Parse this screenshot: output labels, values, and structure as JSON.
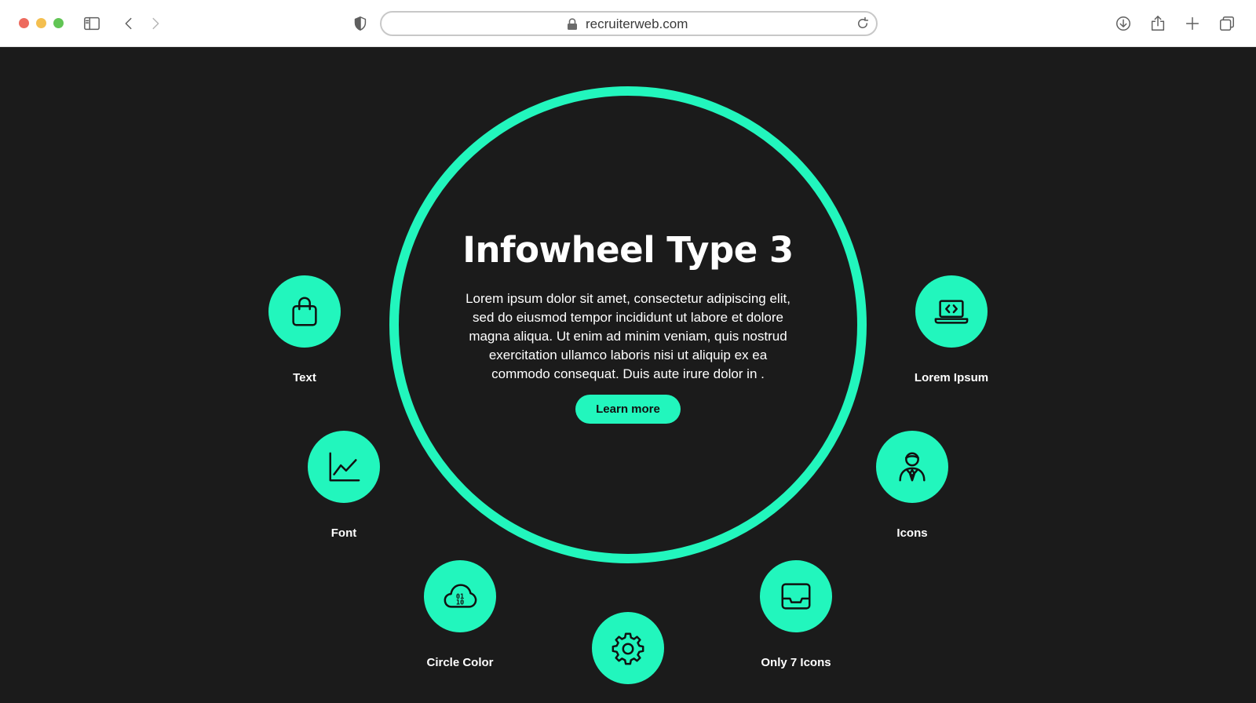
{
  "browser": {
    "url": "recruiterweb.com"
  },
  "main": {
    "title": "Infowheel Type 3",
    "body": "Lorem ipsum dolor sit amet, consectetur adipiscing elit, sed do eiusmod tempor incididunt ut labore et dolore magna aliqua. Ut enim ad minim veniam, quis nostrud exercitation ullamco laboris nisi ut aliquip ex ea commodo consequat. Duis aute irure dolor in .",
    "cta_label": "Learn more"
  },
  "nodes": [
    {
      "label": "Text",
      "icon": "shopping-bag-icon"
    },
    {
      "label": "Font",
      "icon": "line-chart-icon"
    },
    {
      "label": "Circle Color",
      "icon": "cloud-binary-icon"
    },
    {
      "label": "",
      "icon": "gear-icon"
    },
    {
      "label": "Only 7 Icons",
      "icon": "inbox-tray-icon"
    },
    {
      "label": "Icons",
      "icon": "user-tie-icon"
    },
    {
      "label": "Lorem Ipsum",
      "icon": "laptop-code-icon"
    }
  ],
  "colors": {
    "accent": "#22f6bd",
    "background": "#1b1b1b",
    "text": "#ffffff"
  }
}
